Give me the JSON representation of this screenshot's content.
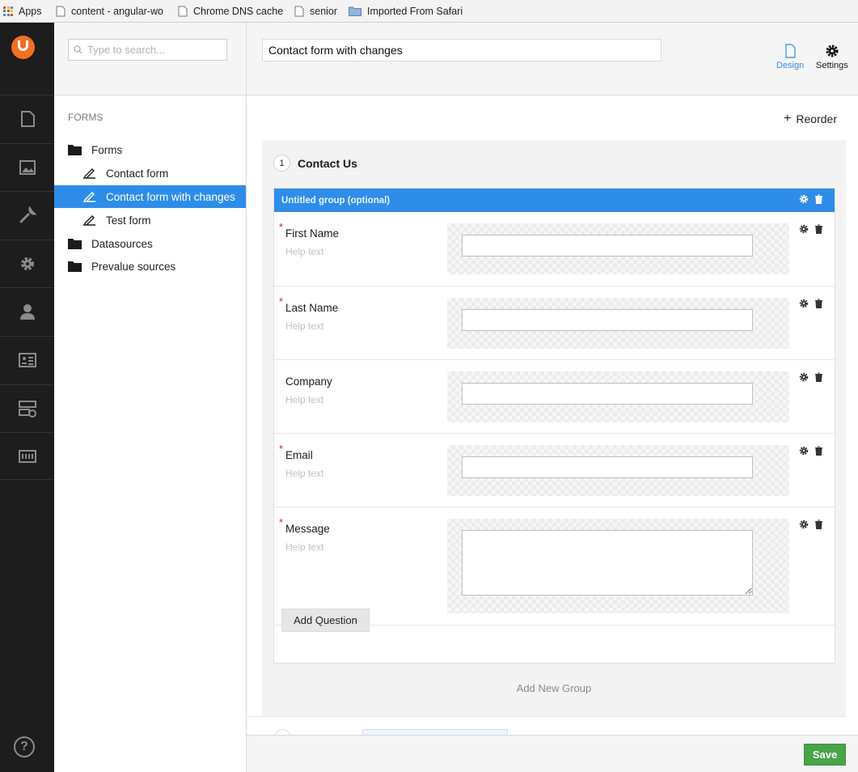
{
  "bookmarks": [
    {
      "label": "Apps",
      "icon": "apps-grid-icon"
    },
    {
      "label": "content - angular-wo",
      "icon": "page-icon"
    },
    {
      "label": "Chrome DNS cache",
      "icon": "page-icon"
    },
    {
      "label": "senior",
      "icon": "page-icon"
    },
    {
      "label": "Imported From Safari",
      "icon": "folder-icon"
    }
  ],
  "rail": {
    "items": [
      "content-icon",
      "media-icon",
      "settings-wrench-icon",
      "developer-gear-icon",
      "users-icon",
      "members-icon",
      "forms-icon",
      "translation-icon"
    ],
    "help": "?"
  },
  "tree": {
    "search_placeholder": "Type to search...",
    "section": "FORMS",
    "forms_folder": "Forms",
    "forms": [
      "Contact form",
      "Contact form with changes",
      "Test form"
    ],
    "datasources": "Datasources",
    "prevalue_sources": "Prevalue sources"
  },
  "header": {
    "form_name": "Contact form with changes",
    "design_label": "Design",
    "settings_label": "Settings"
  },
  "editor": {
    "reorder_label": "Reorder",
    "page_number": "1",
    "page_title": "Contact Us",
    "group_title": "Untitled group (optional)",
    "questions": [
      {
        "label": "First Name",
        "help": "Help text",
        "required": true,
        "type": "text"
      },
      {
        "label": "Last Name",
        "help": "Help text",
        "required": true,
        "type": "text"
      },
      {
        "label": "Company",
        "help": "Help text",
        "required": false,
        "type": "text"
      },
      {
        "label": "Email",
        "help": "Help text",
        "required": true,
        "type": "text"
      },
      {
        "label": "Message",
        "help": "Help text",
        "required": true,
        "type": "textarea"
      }
    ],
    "required_marker": "*",
    "add_question": "Add Question",
    "add_group": "Add New Group"
  },
  "footer": {
    "save_label": "Save"
  },
  "colors": {
    "accent": "#2e8de8",
    "logo": "#f36f22",
    "save": "#46a546",
    "required": "#e2231a"
  }
}
